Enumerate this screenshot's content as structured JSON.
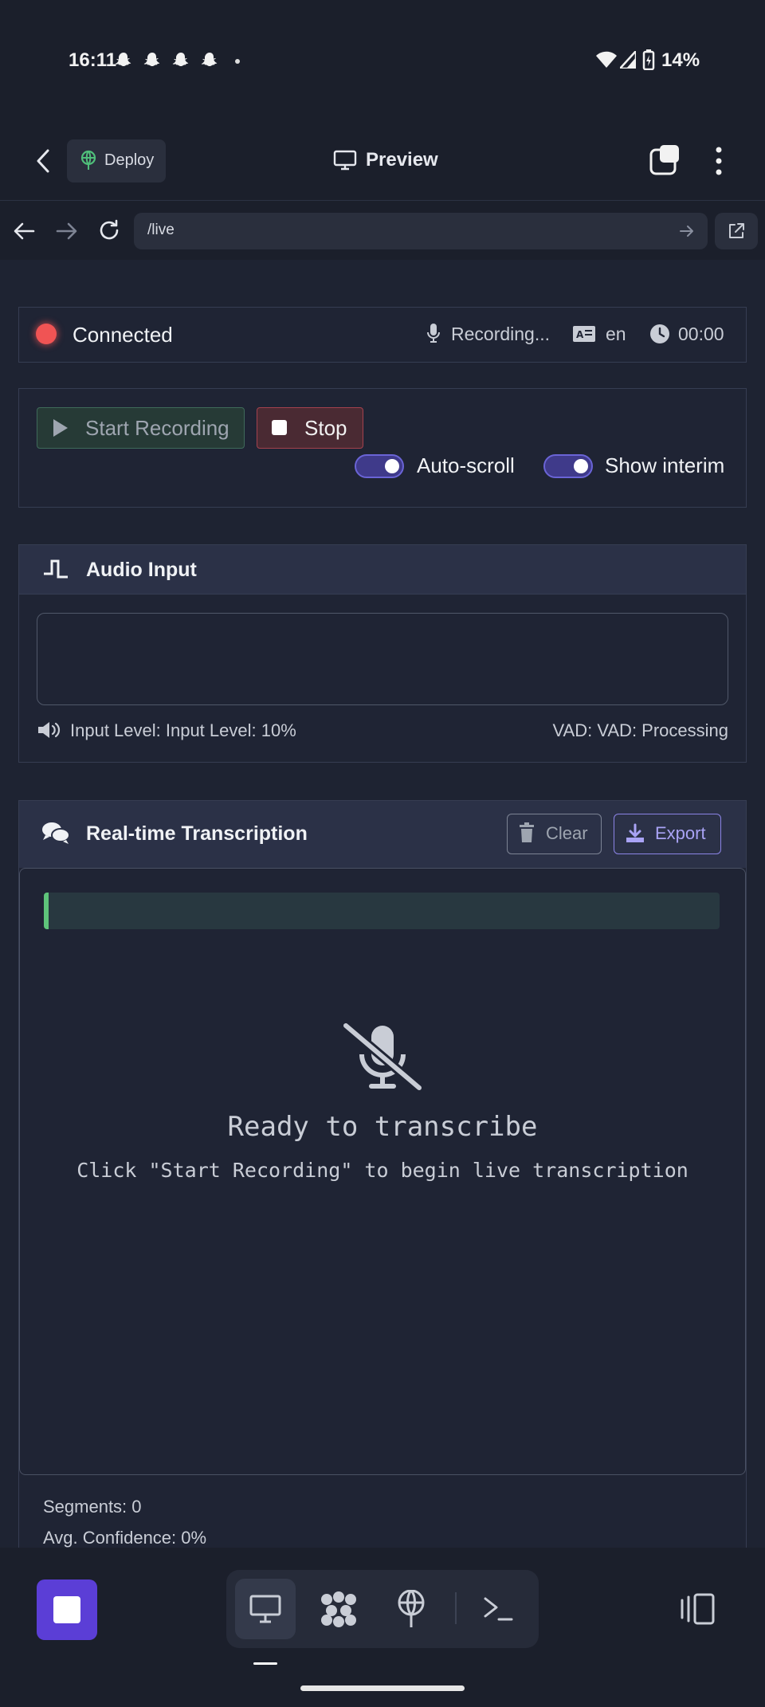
{
  "status_bar": {
    "time": "16:11",
    "battery": "14%"
  },
  "header": {
    "deploy_label": "Deploy",
    "preview_label": "Preview"
  },
  "url_bar": {
    "url": "/live"
  },
  "status": {
    "connection": "Connected",
    "recording": "Recording...",
    "language": "en",
    "timer": "00:00",
    "colors": {
      "indicator": "#f05454"
    }
  },
  "controls": {
    "start_label": "Start Recording",
    "stop_label": "Stop",
    "auto_scroll_label": "Auto-scroll",
    "auto_scroll_on": true,
    "show_interim_label": "Show interim",
    "show_interim_on": true
  },
  "audio_input": {
    "title": "Audio Input",
    "level_text": "Input Level: Input Level: 10%",
    "level": 0.1,
    "vad_text": "VAD: VAD: Processing"
  },
  "transcription": {
    "title": "Real-time Transcription",
    "clear_label": "Clear",
    "export_label": "Export",
    "empty_title": "Ready to transcribe",
    "empty_subtitle": "Click \"Start Recording\" to begin live transcription",
    "segments": "Segments: 0",
    "avg_confidence": "Avg. Confidence: 0%"
  },
  "bottom_nav": {
    "items": [
      "monitor-icon",
      "modules-icon",
      "deploy-icon",
      "terminal-icon"
    ],
    "accent": "#5b3ed6"
  }
}
